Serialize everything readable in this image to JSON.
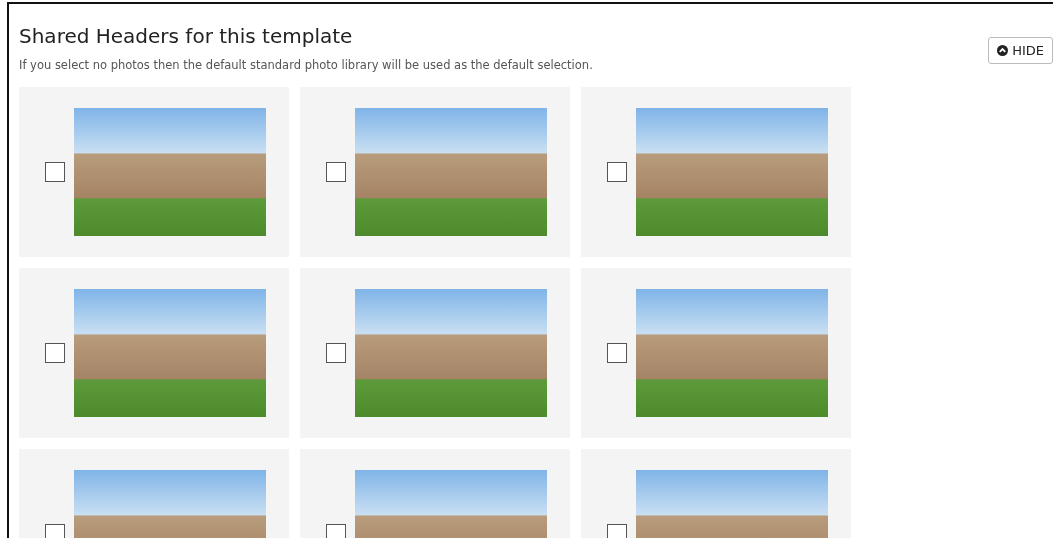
{
  "panel": {
    "title": "Shared Headers for this template",
    "hide_button": "HIDE",
    "description": "If you select no photos then the default standard photo library will be used as the default selection."
  },
  "photos": [
    {
      "checked": false
    },
    {
      "checked": false
    },
    {
      "checked": false
    },
    {
      "checked": false
    },
    {
      "checked": false
    },
    {
      "checked": false
    },
    {
      "checked": false
    },
    {
      "checked": false
    },
    {
      "checked": false
    }
  ]
}
